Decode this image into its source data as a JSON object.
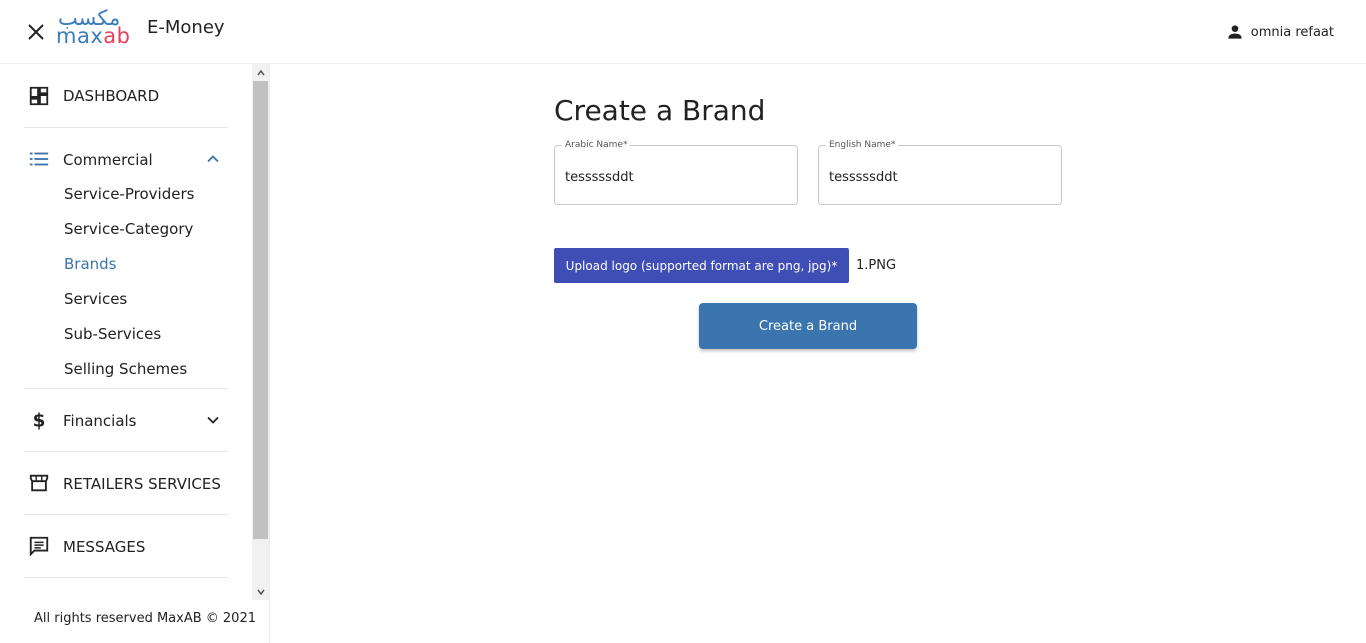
{
  "header": {
    "logo_arabic": "مكسب",
    "logo_max": "max",
    "logo_ab": "ab",
    "app_title": "E-Money",
    "user_name": "omnia refaat"
  },
  "sidebar": {
    "dashboard": "DASHBOARD",
    "commercial": "Commercial",
    "commercial_items": [
      "Service-Providers",
      "Service-Category",
      "Brands",
      "Services",
      "Sub-Services",
      "Selling Schemes"
    ],
    "active_item": "Brands",
    "financials": "Financials",
    "retailers_services": "RETAILERS SERVICES",
    "messages": "MESSAGES",
    "footer": "All rights reserved MaxAB © 2021"
  },
  "form": {
    "title": "Create a Brand",
    "arabic_name_label": "Arabic Name*",
    "arabic_name_value": "tesssssddt",
    "english_name_label": "English Name*",
    "english_name_value": "tesssssddt",
    "upload_label": "Upload logo (supported format are png, jpg)*",
    "file_name": "1.PNG",
    "submit_label": "Create a Brand"
  },
  "colors": {
    "accent": "#3a75b0",
    "upload_button": "#3f4eb5",
    "active_link": "#3d73a8",
    "logo_blue": "#3a7bbf",
    "logo_red": "#e5415a"
  }
}
